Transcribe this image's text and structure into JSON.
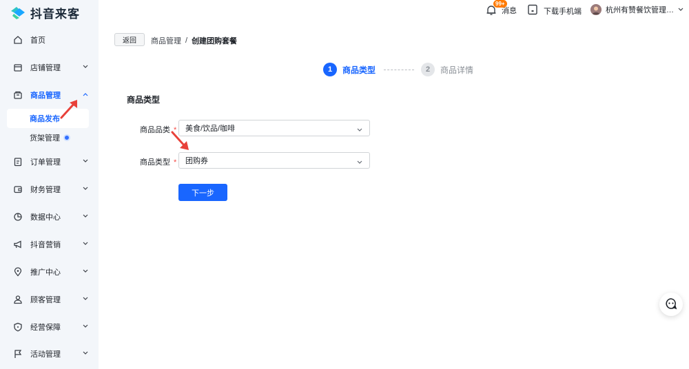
{
  "app": {
    "logo_text": "抖音来客",
    "brand_color": "#1966ff"
  },
  "topbar": {
    "messages_label": "消息",
    "messages_badge": "99+",
    "download_label": "下载手机端",
    "account_name": "杭州有赞餐饮管理…"
  },
  "sidebar": {
    "items": [
      {
        "label": "首页",
        "icon": "home-icon"
      },
      {
        "label": "店铺管理",
        "icon": "store-icon"
      },
      {
        "label": "商品管理",
        "icon": "goods-icon"
      },
      {
        "label": "订单管理",
        "icon": "order-icon"
      },
      {
        "label": "财务管理",
        "icon": "wallet-icon"
      },
      {
        "label": "数据中心",
        "icon": "pie-chart-icon"
      },
      {
        "label": "抖音营销",
        "icon": "megaphone-icon"
      },
      {
        "label": "推广中心",
        "icon": "location-icon"
      },
      {
        "label": "顾客管理",
        "icon": "customer-icon"
      },
      {
        "label": "经营保障",
        "icon": "shield-icon"
      },
      {
        "label": "活动管理",
        "icon": "flag-icon"
      }
    ],
    "sub_items": [
      {
        "label": "商品发布"
      },
      {
        "label": "货架管理"
      }
    ]
  },
  "main": {
    "back_label": "返回",
    "breadcrumb": {
      "parent": "商品管理",
      "separator": "/",
      "current": "创建团购套餐"
    },
    "steps": [
      {
        "num": "1",
        "label": "商品类型"
      },
      {
        "num": "2",
        "label": "商品详情"
      }
    ],
    "section_title": "商品类型",
    "form": {
      "category_label": "商品品类",
      "category_value": "美食/饮品/咖啡",
      "type_label": "商品类型",
      "type_value": "团购券",
      "required_mark": "*"
    },
    "next_label": "下一步"
  }
}
